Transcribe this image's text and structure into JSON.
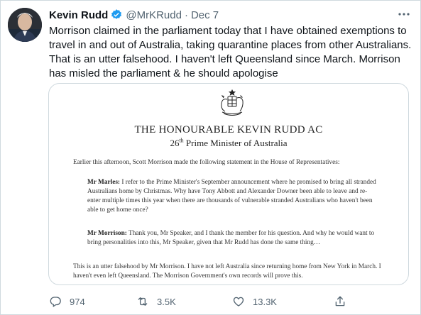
{
  "tweet": {
    "author_name": "Kevin Rudd",
    "handle": "@MrKRudd",
    "separator": "·",
    "date": "Dec 7",
    "text": "Morrison claimed in the parliament today that I have obtained exemptions to travel in and out of Australia, taking quarantine places from other Australians. That is an utter falsehood. I haven't left Queensland since March. Morrison has misled the parliament & he should apologise"
  },
  "letter": {
    "title": "THE HONOURABLE KEVIN RUDD AC",
    "subtitle_number": "26",
    "subtitle_suffix": "th",
    "subtitle_rest": " Prime Minister of Australia",
    "intro": "Earlier this afternoon, Scott Morrison made the following statement in the House of Representatives:",
    "q1_speaker": "Mr Marles:",
    "q1_text": " I refer to the Prime Minister's September announcement where he promised to bring all stranded Australians home by Christmas. Why have Tony Abbott and Alexander Downer been able to leave and re-enter multiple times this year when there are thousands of vulnerable stranded Australians who haven't been able to get home once?",
    "q2_speaker": "Mr Morrison:",
    "q2_text": " Thank you, Mr Speaker, and I thank the member for his question. And why he would want to bring personalities into this, Mr Speaker, given that Mr Rudd has done the same thing…",
    "closing": "This is an utter falsehood by Mr Morrison. I have not left Australia since returning home from New York in March. I haven't even left Queensland. The Morrison Government's own records will prove this."
  },
  "actions": {
    "reply_count": "974",
    "retweet_count": "3.5K",
    "like_count": "13.3K"
  },
  "icons": {
    "verified": "verified-badge-icon",
    "more": "more-options-icon",
    "reply": "reply-icon",
    "retweet": "retweet-icon",
    "like": "heart-icon",
    "share": "share-icon",
    "crest": "coat-of-arms-icon"
  },
  "colors": {
    "verified_blue": "#1d9bf0",
    "text_primary": "#0f1419",
    "text_secondary": "#536471",
    "border": "#cfd9de"
  }
}
